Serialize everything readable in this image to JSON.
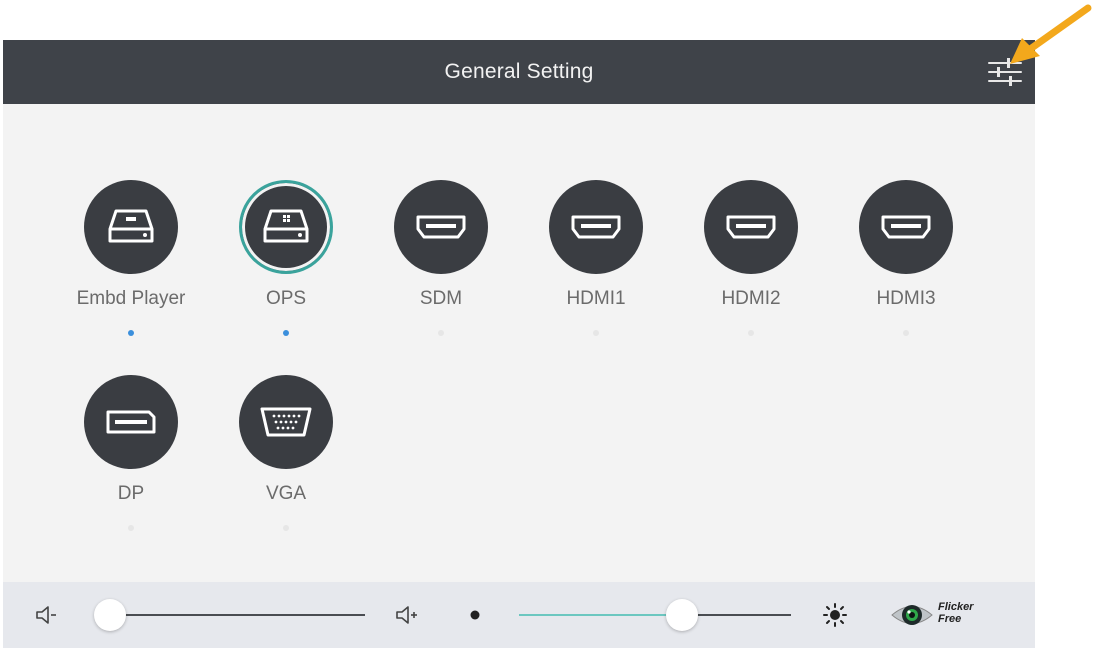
{
  "header": {
    "title": "General Setting"
  },
  "sources": [
    {
      "label": "Embd Player",
      "icon": "storage-device-icon",
      "selected": false,
      "indicator_active": true
    },
    {
      "label": "OPS",
      "icon": "windows-device-icon",
      "selected": true,
      "indicator_active": true
    },
    {
      "label": "SDM",
      "icon": "hdmi-port-icon",
      "selected": false,
      "indicator_active": false
    },
    {
      "label": "HDMI1",
      "icon": "hdmi-port-icon",
      "selected": false,
      "indicator_active": false
    },
    {
      "label": "HDMI2",
      "icon": "hdmi-port-icon",
      "selected": false,
      "indicator_active": false
    },
    {
      "label": "HDMI3",
      "icon": "hdmi-port-icon",
      "selected": false,
      "indicator_active": false
    },
    {
      "label": "DP",
      "icon": "displayport-icon",
      "selected": false,
      "indicator_active": false
    },
    {
      "label": "VGA",
      "icon": "vga-port-icon",
      "selected": false,
      "indicator_active": false
    }
  ],
  "bottom_bar": {
    "volume_level": 0.05,
    "brightness_level": 0.6,
    "logo": {
      "line1": "Flicker",
      "line2": "Free"
    }
  },
  "colors": {
    "header_bg": "#3f4349",
    "accent_teal": "#3aa39c",
    "indicator_blue": "#3b8fdc",
    "arrow_orange": "#f3a81c"
  }
}
